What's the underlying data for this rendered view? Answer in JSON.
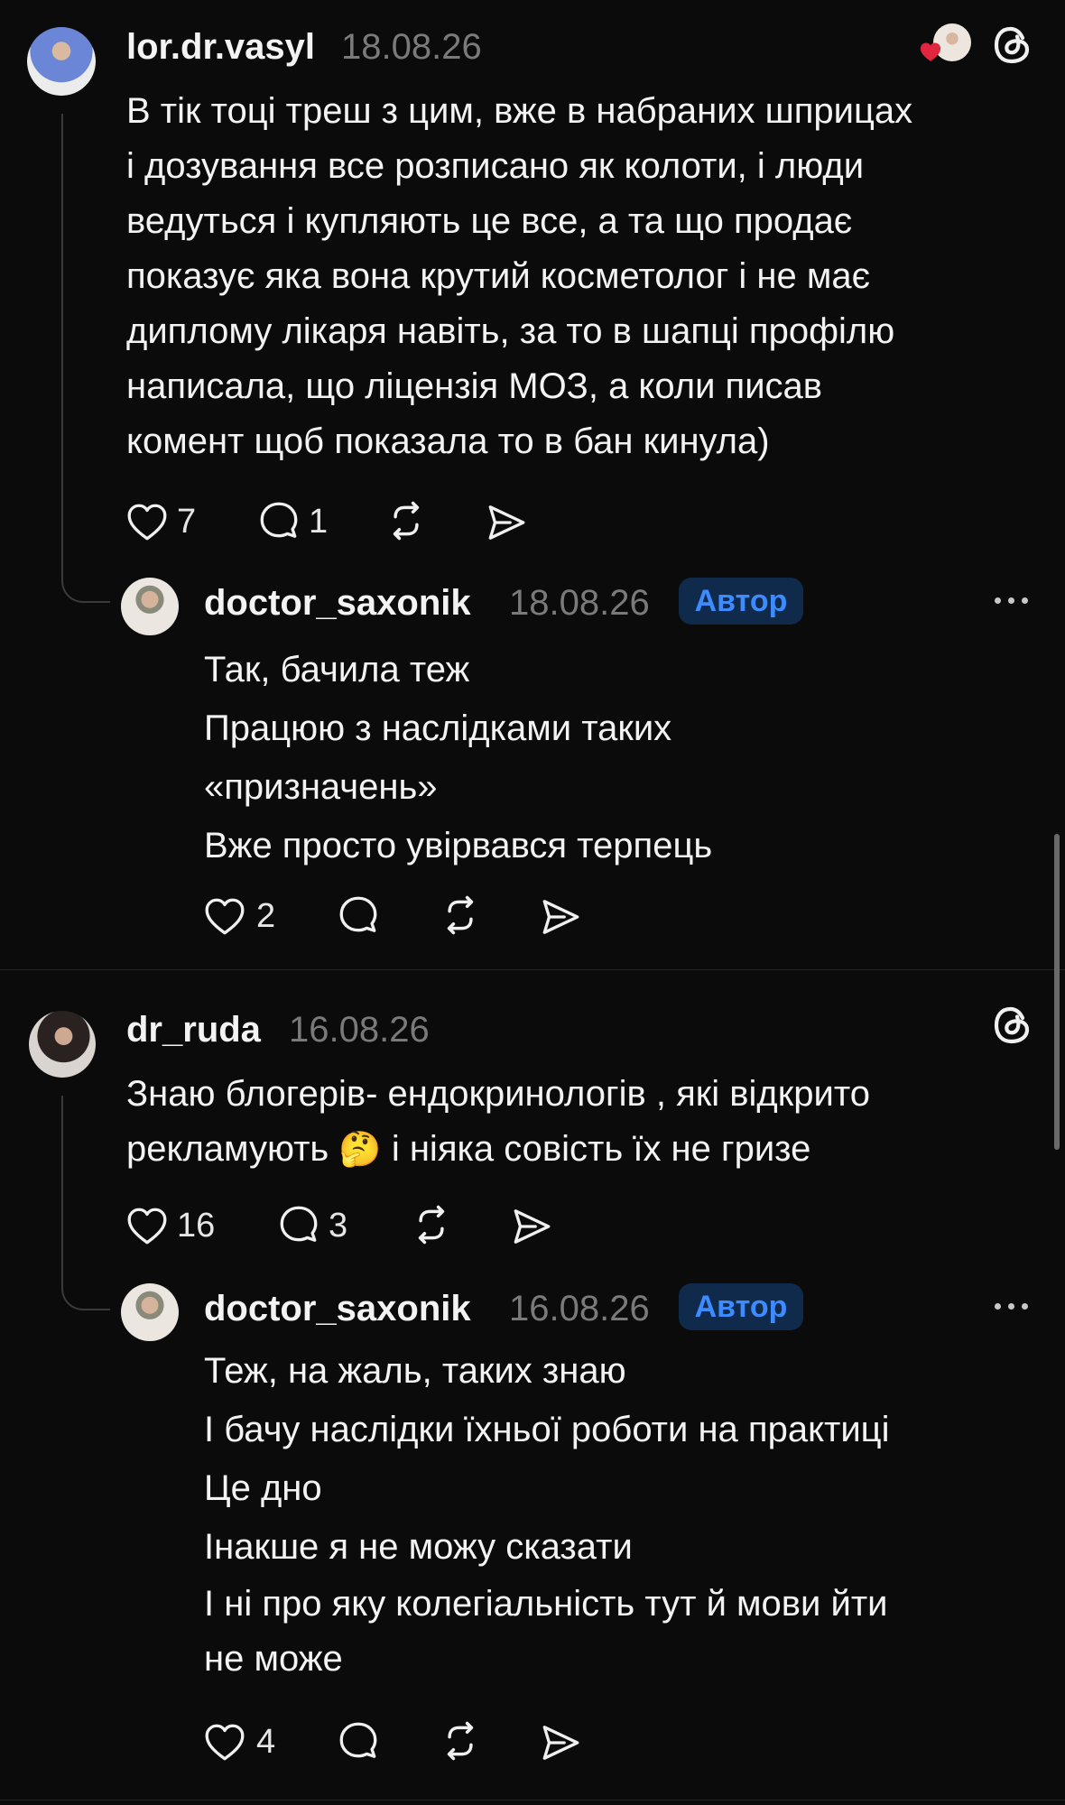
{
  "comments": [
    {
      "username": "lor.dr.vasyl",
      "date": "18.08.26",
      "lines": [
        "В тік тоці треш з цим, вже в набраних шприцах",
        "і дозування все розписано як колоти, і люди",
        "ведуться і купляють це все, а та що продає",
        "показує яка вона крутий косметолог і не має",
        "диплому лікаря навіть, за то в шапці профілю",
        "написала, що ліцензія МОЗ, а коли писав",
        "комент щоб показала то в бан кинула)"
      ],
      "likes": "7",
      "replies": "1",
      "liked_by_author_icon": "heart-icon",
      "threads_icon": "threads-logo-icon",
      "reply": {
        "username": "doctor_saxonik",
        "date": "18.08.26",
        "badge": "Автор",
        "lines": [
          "Так, бачила теж",
          "Працюю з наслідками таких",
          "«призначень»",
          "Вже просто увірвався терпець"
        ],
        "likes": "2"
      }
    },
    {
      "username": "dr_ruda",
      "date": "16.08.26",
      "lines_before_emoji": "Знаю блогерів- ендокринологів , які відкрито",
      "line2_start": "рекламують",
      "emoji": "🤔",
      "line2_end": "і ніяка совість їх не гризе",
      "likes": "16",
      "replies": "3",
      "threads_icon": "threads-logo-icon",
      "reply": {
        "username": "doctor_saxonik",
        "date": "16.08.26",
        "badge": "Автор",
        "lines": [
          "Теж, на жаль, таких знаю",
          "І бачу наслідки їхньої роботи на практиці",
          "Це дно",
          "Інакше я не можу сказати",
          "І ні про яку колегіальність тут й мови йти",
          "не може"
        ],
        "likes": "4"
      }
    }
  ],
  "colors": {
    "background": "#0b0b0b",
    "badge_bg": "#0f2a4a",
    "badge_text": "#3d8bff",
    "heart": "#e3263f"
  }
}
